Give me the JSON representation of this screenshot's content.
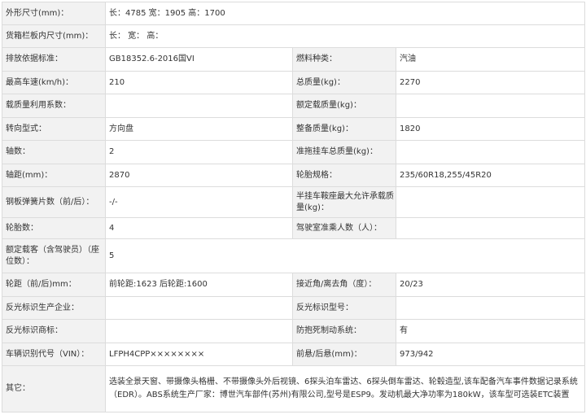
{
  "rows": [
    {
      "l1": "外形尺寸(mm)：",
      "v1": "长：4785 宽：1905 高：1700"
    },
    {
      "l1": "货箱栏板内尺寸(mm)：",
      "v1": "长： 宽： 高："
    },
    {
      "l1": "排放依据标准：",
      "v1": "GB18352.6-2016国VI",
      "l2": "燃料种类：",
      "v2": "汽油"
    },
    {
      "l1": "最高车速(km/h)：",
      "v1": "210",
      "l2": "总质量(kg)：",
      "v2": "2270"
    },
    {
      "l1": "载质量利用系数：",
      "v1": "",
      "l2": "额定载质量(kg)：",
      "v2": ""
    },
    {
      "l1": "转向型式：",
      "v1": "方向盘",
      "l2": "整备质量(kg)：",
      "v2": "1820"
    },
    {
      "l1": "轴数：",
      "v1": "2",
      "l2": "准拖挂车总质量(kg)：",
      "v2": ""
    },
    {
      "l1": "轴距(mm)：",
      "v1": "2870",
      "l2": "轮胎规格：",
      "v2": "235/60R18,255/45R20"
    },
    {
      "l1": "钢板弹簧片数（前/后）：",
      "v1": "-/-",
      "l2": "半挂车鞍座最大允许承载质量(kg)：",
      "v2": ""
    },
    {
      "l1": "轮胎数：",
      "v1": "4",
      "l2": "驾驶室准乘人数（人）：",
      "v2": ""
    },
    {
      "l1": "额定载客（含驾驶员）（座位数）：",
      "v1": "5"
    },
    {
      "l1": "轮距（前/后)mm：",
      "v1": "前轮距:1623 后轮距:1600",
      "l2": "接近角/离去角（度）：",
      "v2": "20/23"
    },
    {
      "l1": "反光标识生产企业：",
      "v1": "",
      "l2": "反光标识型号：",
      "v2": ""
    },
    {
      "l1": "反光标识商标：",
      "v1": "",
      "l2": "防抱死制动系统：",
      "v2": "有"
    },
    {
      "l1": "车辆识别代号（VIN）：",
      "v1": "LFPH4CPP××××××××",
      "l2": "前悬/后悬(mm)：",
      "v2": "973/942"
    },
    {
      "l1": "其它：",
      "v1": "选装全景天窗、带摄像头格栅、不带摄像头外后视镜、6探头泊车雷达、6探头倒车雷达、轮毂造型,该车配备汽车事件数据记录系统（EDR）。ABS系统生产厂家：博世汽车部件(苏州)有限公司,型号是ESP9。发动机最大净功率为180kW，该车型可选装ETC装置"
    }
  ]
}
